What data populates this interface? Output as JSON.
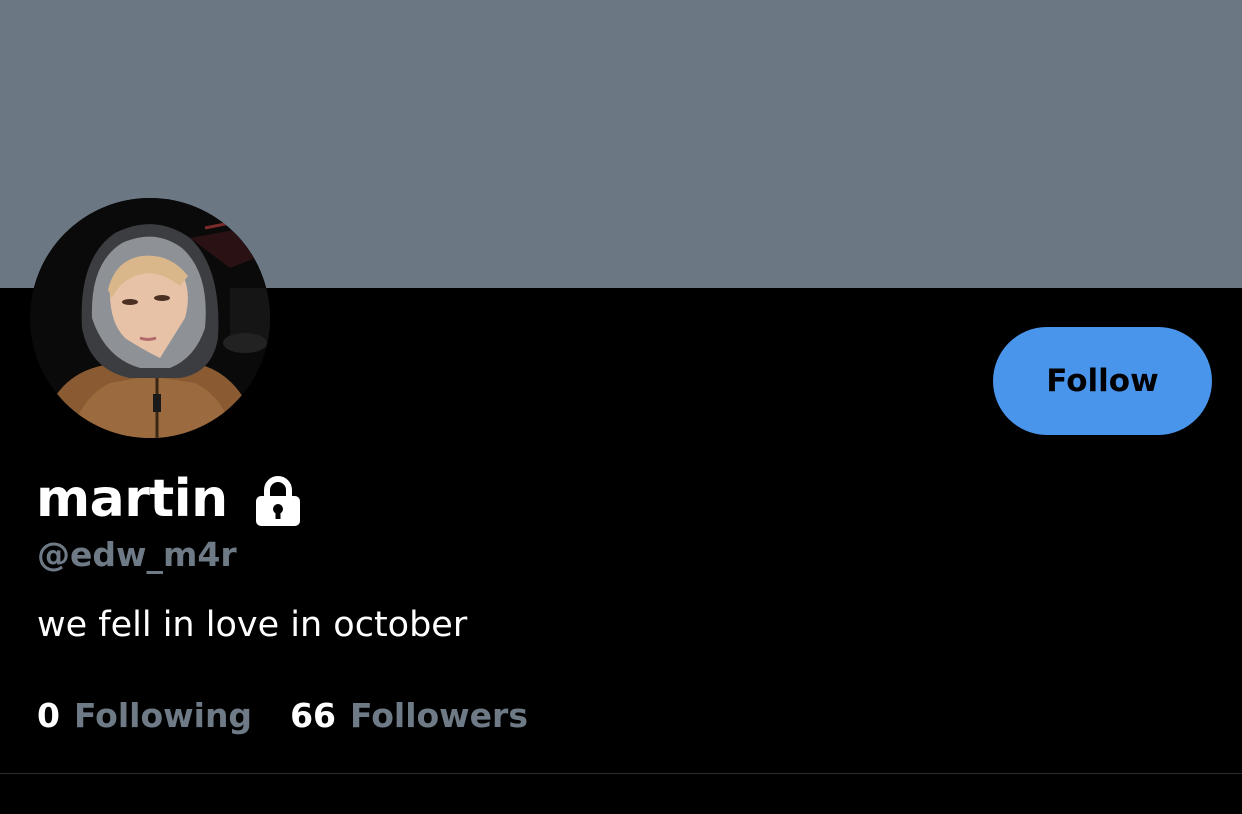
{
  "profile": {
    "display_name": "martin",
    "handle": "@edw_m4r",
    "bio": "we fell in love in october",
    "protected_icon": "lock-icon",
    "avatar": "profile-photo"
  },
  "actions": {
    "follow_label": "Follow"
  },
  "stats": {
    "following_count": "0",
    "following_label": "Following",
    "followers_count": "66",
    "followers_label": "Followers"
  },
  "colors": {
    "banner": "#6b7884",
    "background": "#000000",
    "follow_button": "#4a95ec",
    "secondary_text": "#6e7b86",
    "primary_text": "#ffffff"
  }
}
